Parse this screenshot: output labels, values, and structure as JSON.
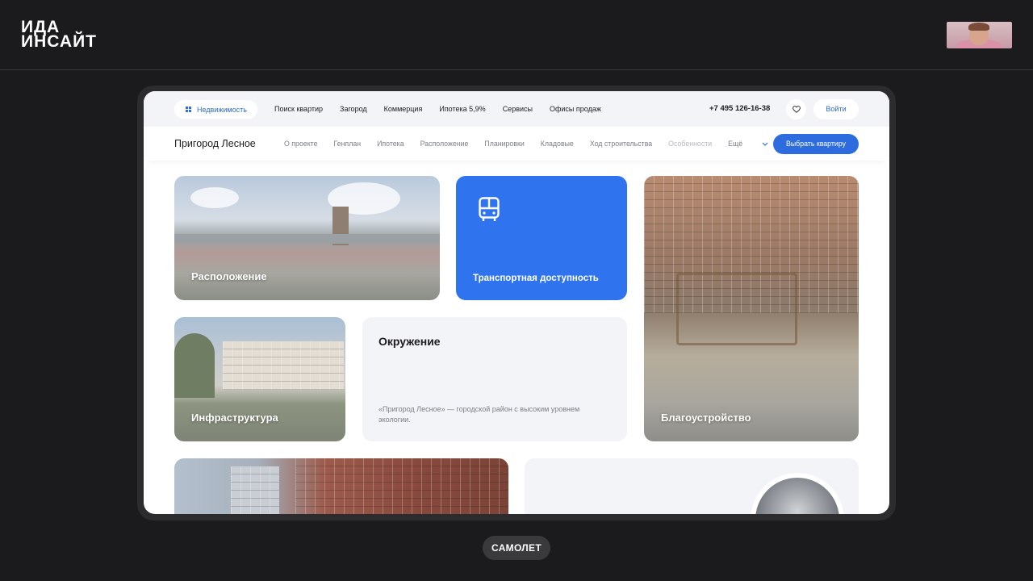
{
  "brand": {
    "line1": "ИДА",
    "line2": "ИНСАЙТ"
  },
  "caption": "САМОЛЕТ",
  "site": {
    "topbar": {
      "realty_label": "Недвижимость",
      "nav": [
        "Поиск квартир",
        "Загород",
        "Коммерция",
        "Ипотека 5,9%",
        "Сервисы",
        "Офисы продаж"
      ],
      "phone": "+7 495 126-16-38",
      "login_label": "Войти"
    },
    "subbar": {
      "project_title": "Пригород Лесное",
      "nav": [
        "О проекте",
        "Генплан",
        "Ипотека",
        "Расположение",
        "Планировки",
        "Кладовые",
        "Ход строительства"
      ],
      "nav_muted": "Особенности",
      "more_label": "Ещё",
      "cta_label": "Выбрать квартиру"
    },
    "cards": {
      "location": "Расположение",
      "transport": "Транспортная доступность",
      "landscape": "Благоустройство",
      "infrastructure": "Инфраструктура",
      "environment": {
        "title": "Окружение",
        "description": "«Пригород Лесное» — городской район с высоким уровнем экологии."
      }
    }
  },
  "colors": {
    "accent": "#2f74ee",
    "link": "#2d6cdf",
    "frame": "#1b1b1d",
    "card_bg": "#f3f4f8"
  },
  "icons": [
    "grid-icon",
    "heart-icon",
    "chevron-down-icon",
    "bus-icon"
  ]
}
